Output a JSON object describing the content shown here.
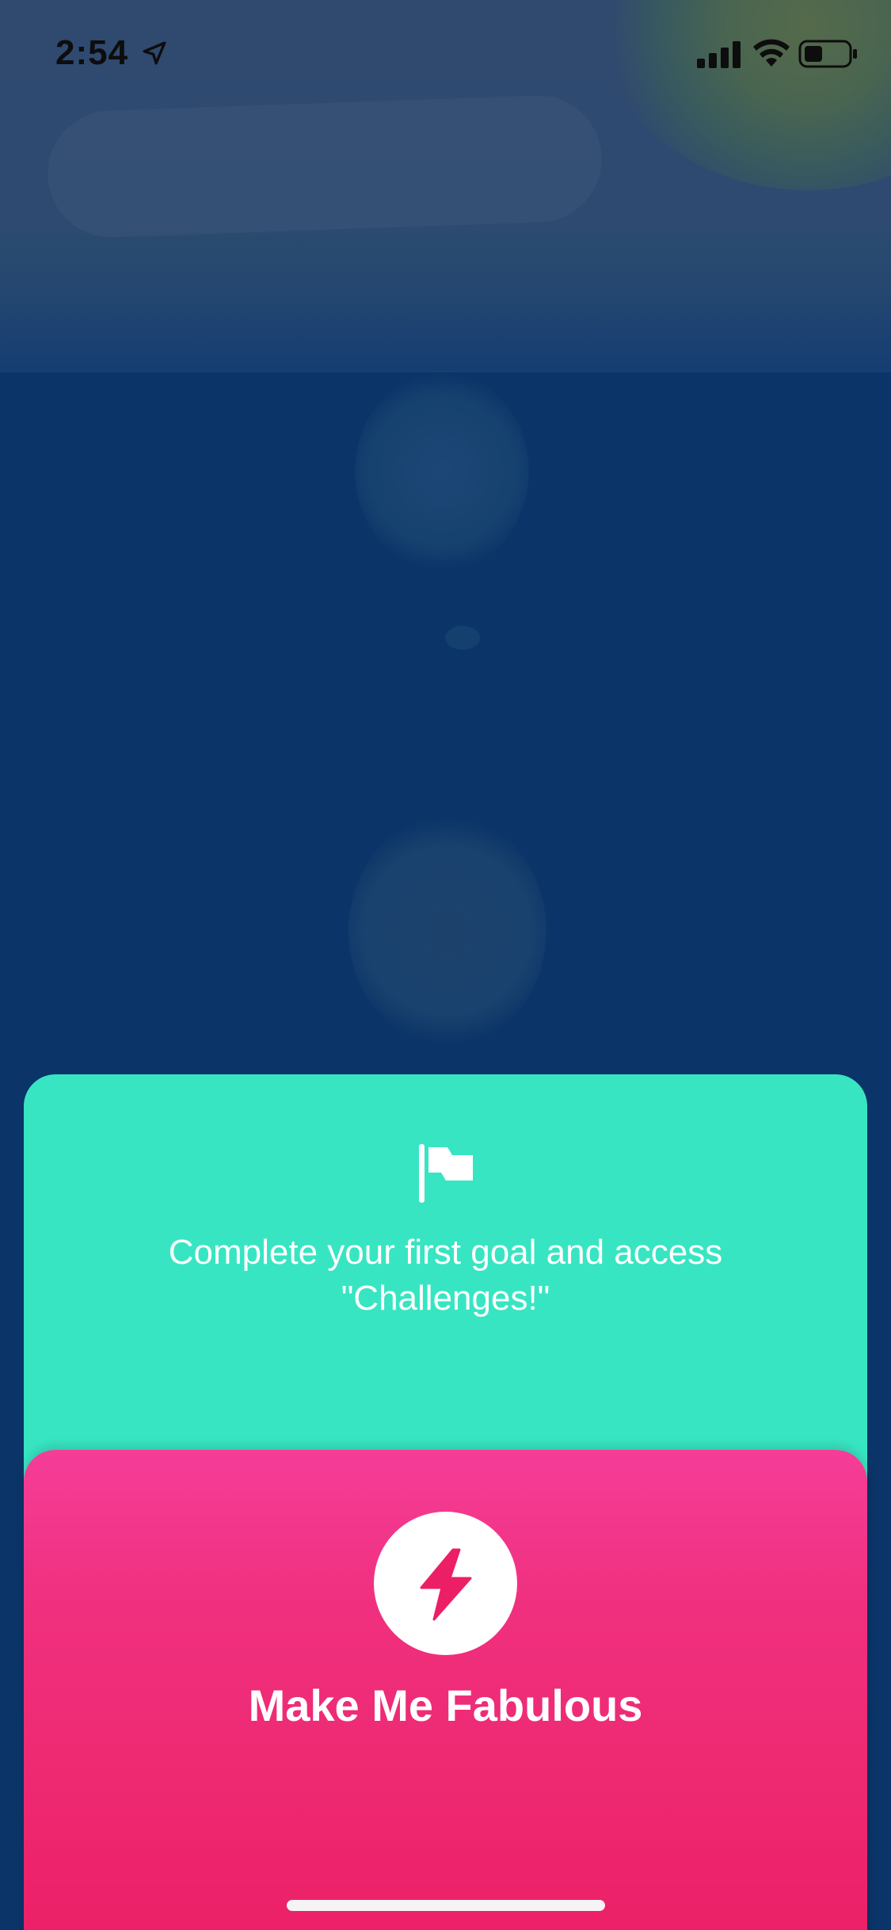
{
  "status_bar": {
    "time": "2:54",
    "icons": [
      "location-arrow-icon",
      "signal-icon",
      "wifi-icon",
      "battery-icon"
    ]
  },
  "goal_card": {
    "icon": "flag-icon",
    "text": "Complete your first goal and access\n\"Challenges!\"",
    "color": "#38e5c2"
  },
  "fabulous_card": {
    "icon": "lightning-bolt-icon",
    "button_label": "Make Me Fabulous",
    "color_top": "#f53d98",
    "color_bottom": "#ec1f66"
  }
}
